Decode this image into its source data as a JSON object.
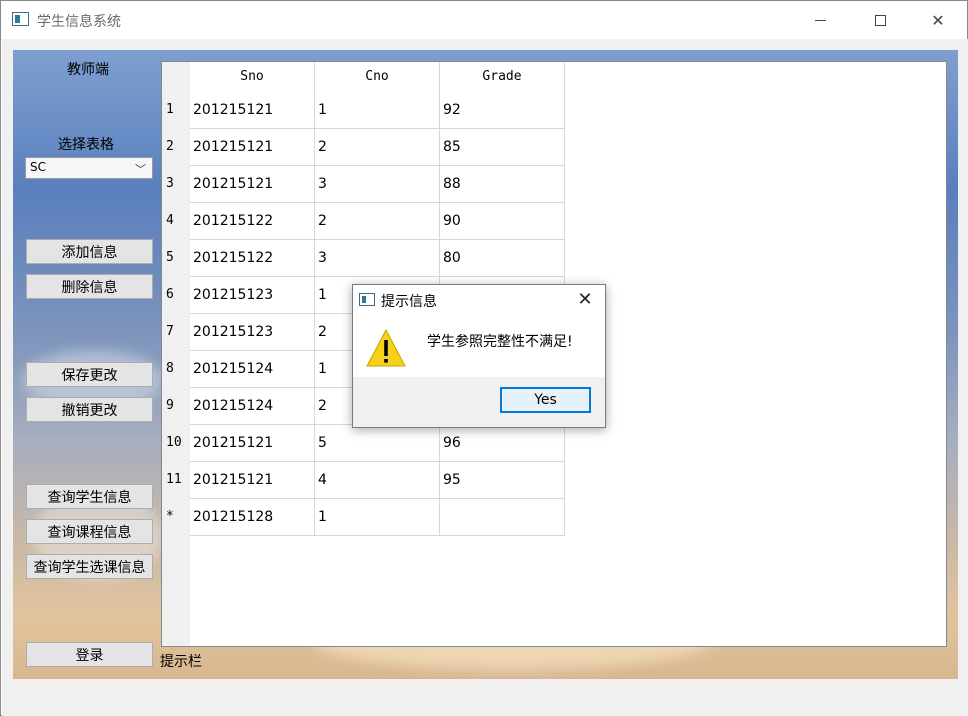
{
  "window": {
    "title": "学生信息系统",
    "controls": {
      "minimize": "minimize",
      "maximize": "maximize",
      "close": "close"
    }
  },
  "sidebar": {
    "role_label": "教师端",
    "select_label": "选择表格",
    "table_select": {
      "value": "SC"
    },
    "buttons": {
      "add": "添加信息",
      "delete": "删除信息",
      "save": "保存更改",
      "cancel": "撤销更改",
      "query_student": "查询学生信息",
      "query_course": "查询课程信息",
      "query_sc": "查询学生选课信息",
      "login": "登录"
    }
  },
  "table": {
    "columns": [
      "Sno",
      "Cno",
      "Grade"
    ],
    "rows": [
      {
        "num": "1",
        "cells": [
          "201215121",
          "1",
          "92"
        ]
      },
      {
        "num": "2",
        "cells": [
          "201215121",
          "2",
          "85"
        ]
      },
      {
        "num": "3",
        "cells": [
          "201215121",
          "3",
          "88"
        ]
      },
      {
        "num": "4",
        "cells": [
          "201215122",
          "2",
          "90"
        ]
      },
      {
        "num": "5",
        "cells": [
          "201215122",
          "3",
          "80"
        ]
      },
      {
        "num": "6",
        "cells": [
          "201215123",
          "1",
          ""
        ]
      },
      {
        "num": "7",
        "cells": [
          "201215123",
          "2",
          ""
        ]
      },
      {
        "num": "8",
        "cells": [
          "201215124",
          "1",
          ""
        ]
      },
      {
        "num": "9",
        "cells": [
          "201215124",
          "2",
          ""
        ]
      },
      {
        "num": "10",
        "cells": [
          "201215121",
          "5",
          "96"
        ]
      },
      {
        "num": "11",
        "cells": [
          "201215121",
          "4",
          "95"
        ]
      },
      {
        "num": "*",
        "cells": [
          "201215128",
          "1",
          ""
        ]
      }
    ]
  },
  "status_bar": {
    "label": "提示栏"
  },
  "dialog": {
    "title": "提示信息",
    "message": "学生参照完整性不满足!",
    "icon": "warning-icon",
    "yes_label": "Yes"
  },
  "colors": {
    "dialog_button_border": "#0078d7",
    "warning_yellow": "#f7d117"
  }
}
